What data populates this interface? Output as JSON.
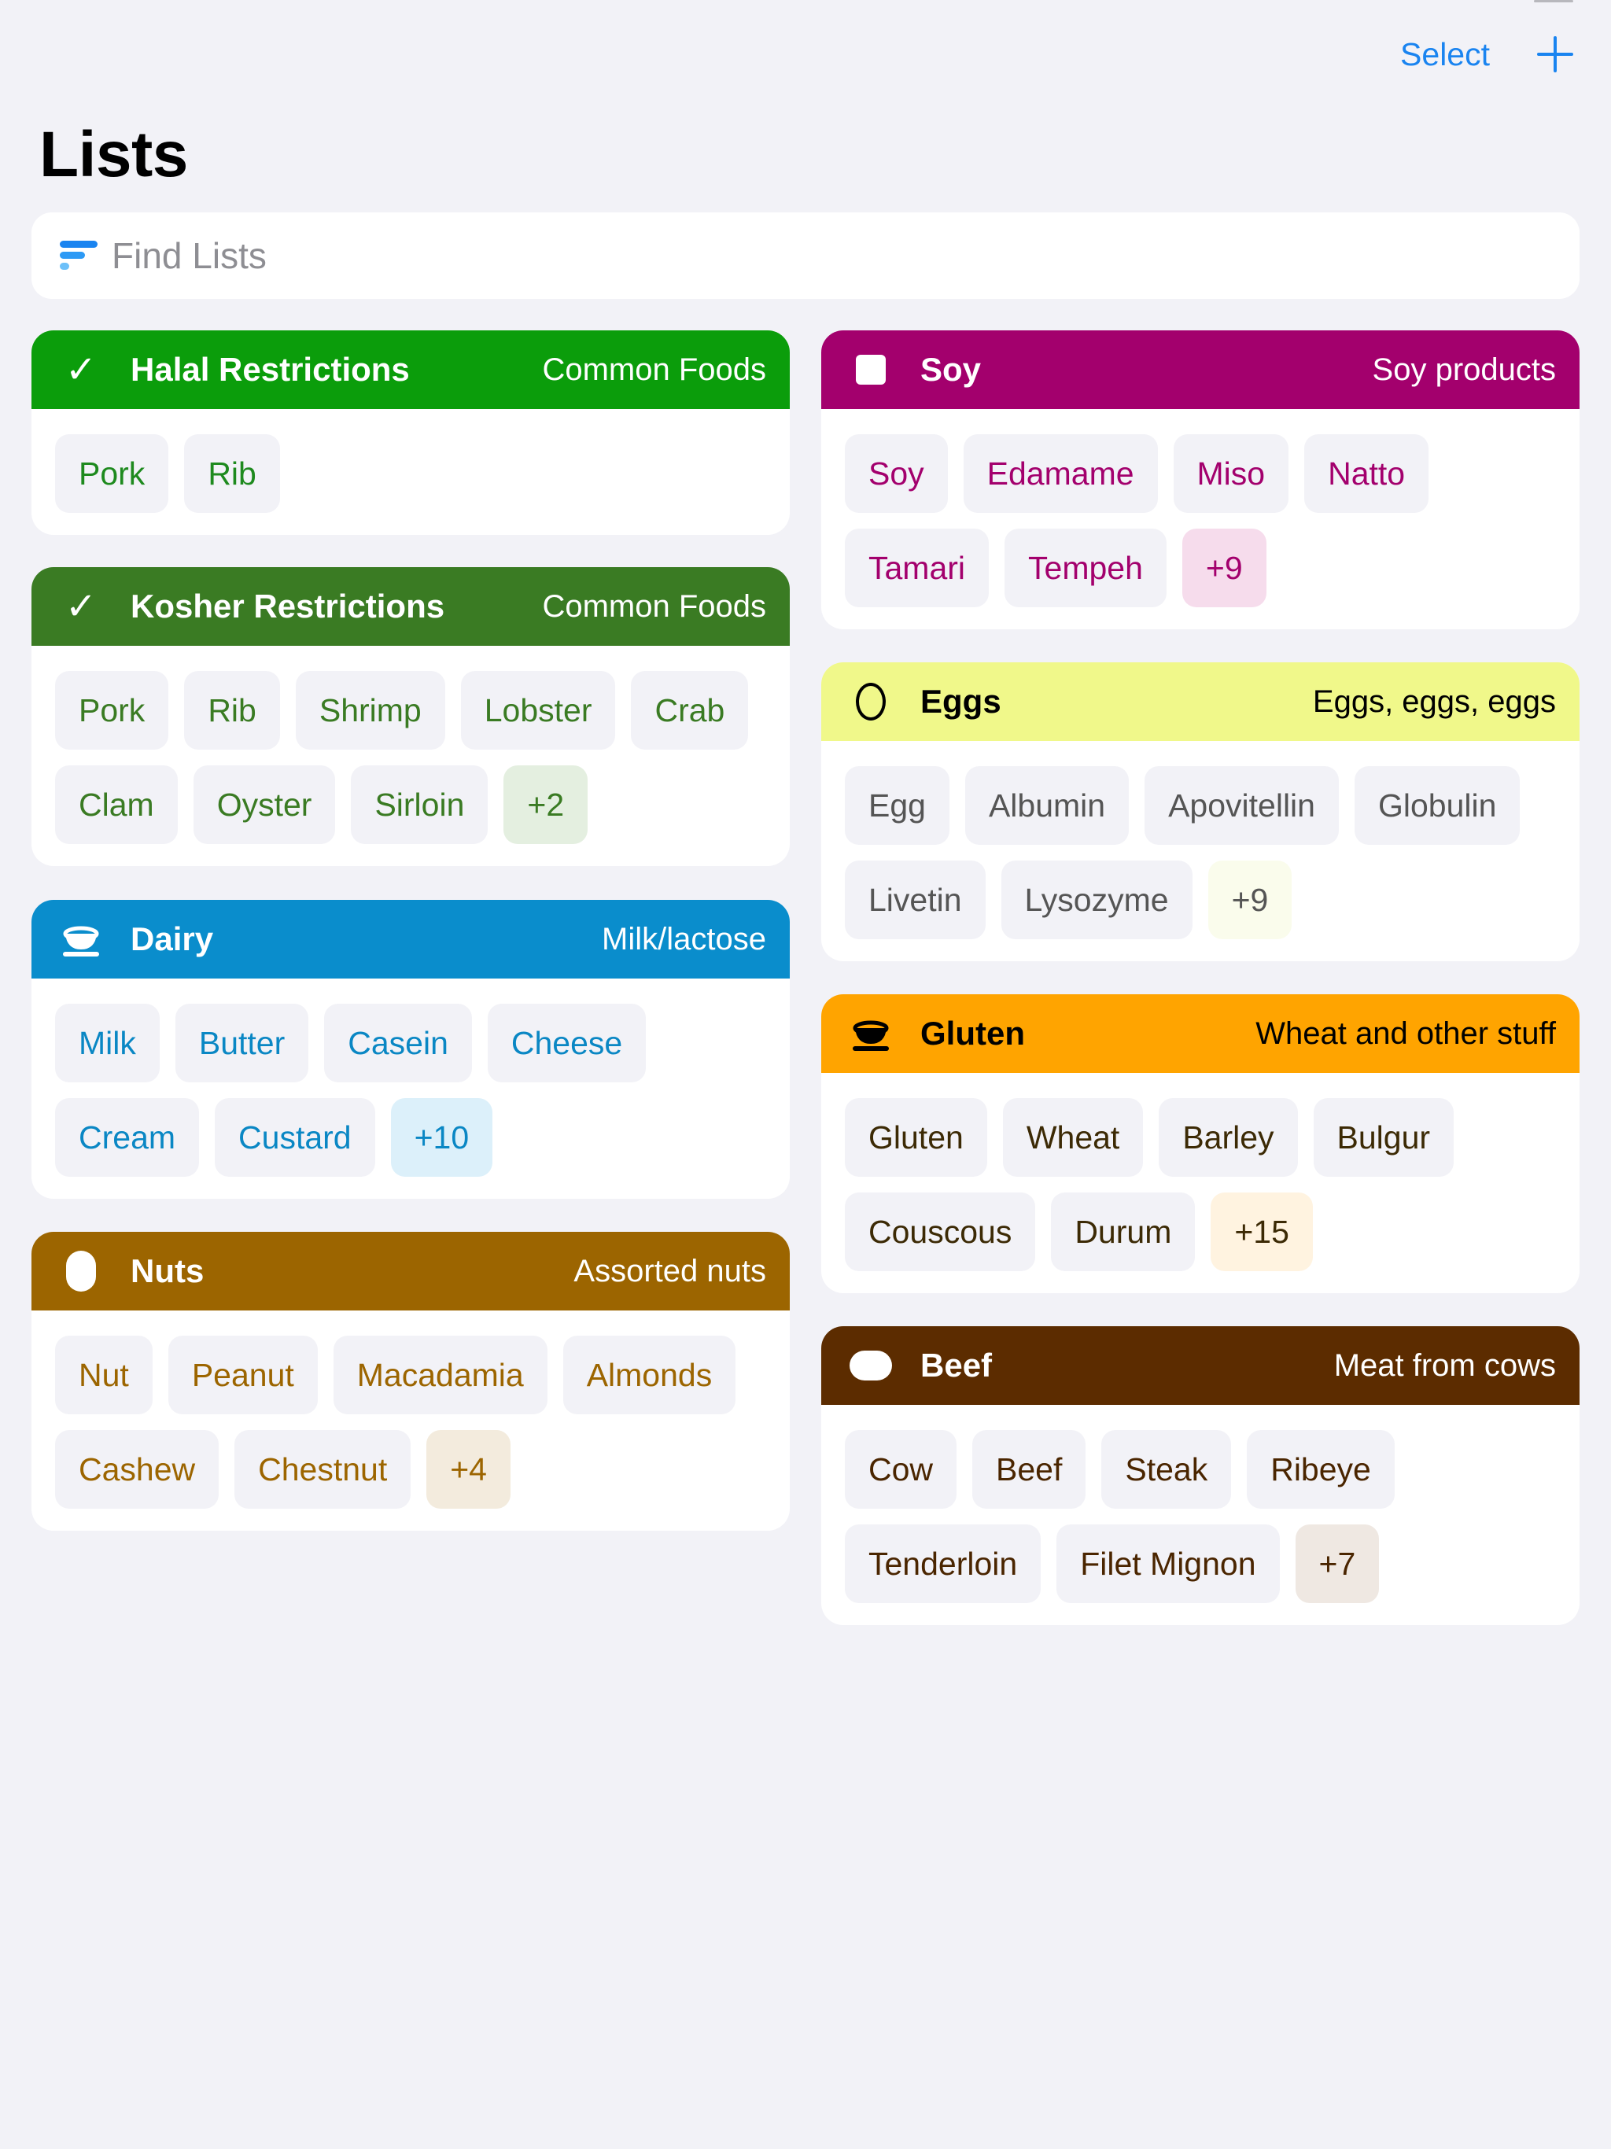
{
  "nav": {
    "select_label": "Select",
    "add_icon": "plus-icon"
  },
  "page_title": "Lists",
  "search": {
    "placeholder": "Find Lists",
    "value": "",
    "icon": "filter-lines-icon"
  },
  "left_column": [
    {
      "id": "halal",
      "icon": "checkmark-icon",
      "title": "Halal Restrictions",
      "subtitle": "Common Foods",
      "header_color": "#0b9d0b",
      "header_text_color": "#ffffff",
      "chip_text_color": "#1e8a1e",
      "more_chip_bg": "#e4f0e4",
      "items": [
        "Pork",
        "Rib"
      ],
      "more": ""
    },
    {
      "id": "kosher",
      "icon": "checkmark-icon",
      "title": "Kosher Restrictions",
      "subtitle": "Common Foods",
      "header_color": "#3a7b23",
      "header_text_color": "#ffffff",
      "chip_text_color": "#3a7b23",
      "more_chip_bg": "#e4efe0",
      "items": [
        "Pork",
        "Rib",
        "Shrimp",
        "Lobster",
        "Crab",
        "Clam",
        "Oyster",
        "Sirloin"
      ],
      "more": "+2"
    },
    {
      "id": "dairy",
      "icon": "coffee-cup-icon",
      "title": "Dairy",
      "subtitle": "Milk/lactose",
      "header_color": "#0a8dcc",
      "header_text_color": "#ffffff",
      "chip_text_color": "#0a87c4",
      "more_chip_bg": "#dcf0fa",
      "items": [
        "Milk",
        "Butter",
        "Casein",
        "Cheese",
        "Cream",
        "Custard"
      ],
      "more": "+10"
    },
    {
      "id": "nuts",
      "icon": "pill-shape-icon",
      "title": "Nuts",
      "subtitle": "Assorted nuts",
      "header_color": "#9c6500",
      "header_text_color": "#ffffff",
      "chip_text_color": "#9c6500",
      "more_chip_bg": "#f3ebdd",
      "items": [
        "Nut",
        "Peanut",
        "Macadamia",
        "Almonds",
        "Cashew",
        "Chestnut"
      ],
      "more": "+4"
    }
  ],
  "right_column": [
    {
      "id": "soy",
      "icon": "square-icon",
      "title": "Soy",
      "subtitle": "Soy products",
      "header_color": "#a3006d",
      "header_text_color": "#ffffff",
      "chip_text_color": "#a3006d",
      "more_chip_bg": "#f6dcec",
      "items": [
        "Soy",
        "Edamame",
        "Miso",
        "Natto",
        "Tamari",
        "Tempeh"
      ],
      "more": "+9"
    },
    {
      "id": "eggs",
      "icon": "egg-outline-icon",
      "title": "Eggs",
      "subtitle": "Eggs, eggs, eggs",
      "header_color": "#f0f88a",
      "header_text_color": "#000000",
      "chip_text_color": "#555555",
      "more_chip_bg": "#fafcec",
      "items": [
        "Egg",
        "Albumin",
        "Apovitellin",
        "Globulin",
        "Livetin",
        "Lysozyme"
      ],
      "more": "+9"
    },
    {
      "id": "gluten",
      "icon": "coffee-cup-icon",
      "title": "Gluten",
      "subtitle": "Wheat and other stuff",
      "header_color": "#ffa400",
      "header_text_color": "#000000",
      "chip_text_color": "#3c2a05",
      "more_chip_bg": "#fff3e0",
      "items": [
        "Gluten",
        "Wheat",
        "Barley",
        "Bulgur",
        "Couscous",
        "Durum"
      ],
      "more": "+15"
    },
    {
      "id": "beef",
      "icon": "pill-shape-icon",
      "title": "Beef",
      "subtitle": "Meat from cows",
      "header_color": "#5c2c00",
      "header_text_color": "#ffffff",
      "chip_text_color": "#4a2500",
      "more_chip_bg": "#efe8e2",
      "items": [
        "Cow",
        "Beef",
        "Steak",
        "Ribeye",
        "Tenderloin",
        "Filet Mignon"
      ],
      "more": "+7"
    }
  ]
}
